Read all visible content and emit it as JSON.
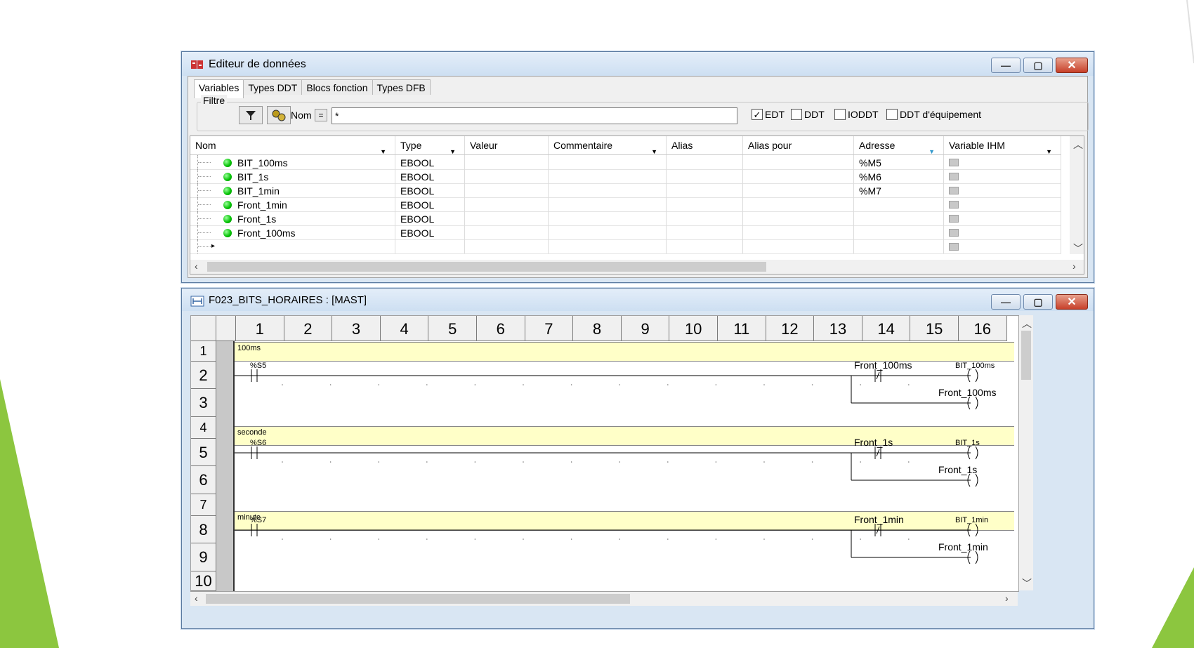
{
  "data_editor": {
    "title": "Editeur de données",
    "tabs": [
      "Variables",
      "Types DDT",
      "Blocs fonction",
      "Types DFB"
    ],
    "filter_label": "Filtre",
    "name_label": "Nom",
    "eq_label": "=",
    "name_filter_value": "*",
    "checkboxes": [
      {
        "label": "EDT",
        "checked": true
      },
      {
        "label": "DDT",
        "checked": false
      },
      {
        "label": "IODDT",
        "checked": false
      },
      {
        "label": "DDT d'équipement",
        "checked": false
      }
    ],
    "columns": [
      "Nom",
      "Type",
      "Valeur",
      "Commentaire",
      "Alias",
      "Alias pour",
      "Adresse",
      "Variable IHM"
    ],
    "rows": [
      {
        "name": "BIT_100ms",
        "type": "EBOOL",
        "address": "%M5"
      },
      {
        "name": "BIT_1s",
        "type": "EBOOL",
        "address": "%M6"
      },
      {
        "name": "BIT_1min",
        "type": "EBOOL",
        "address": "%M7"
      },
      {
        "name": "Front_1min",
        "type": "EBOOL",
        "address": ""
      },
      {
        "name": "Front_1s",
        "type": "EBOOL",
        "address": ""
      },
      {
        "name": "Front_100ms",
        "type": "EBOOL",
        "address": ""
      }
    ]
  },
  "ladder_editor": {
    "title": "F023_BITS_HORAIRES : [MAST]",
    "columns": [
      "1",
      "2",
      "3",
      "4",
      "5",
      "6",
      "7",
      "8",
      "9",
      "10",
      "11",
      "12",
      "13",
      "14",
      "15",
      "16"
    ],
    "row_numbers": [
      "1",
      "2",
      "3",
      "4",
      "5",
      "6",
      "7",
      "8",
      "9",
      "10"
    ],
    "comments": [
      "100ms",
      "seconde",
      "minute"
    ],
    "rungs": [
      {
        "contact": "%S5",
        "nc_contact": "Front_100ms",
        "coil_small": "BIT_100ms",
        "coil2": "Front_100ms"
      },
      {
        "contact": "%S6",
        "nc_contact": "Front_1s",
        "coil_small": "BIT_1s",
        "coil2": "Front_1s"
      },
      {
        "contact": "%S7",
        "nc_contact": "Front_1min",
        "coil_small": "BIT_1min",
        "coil2": "Front_1min"
      }
    ]
  },
  "colors": {
    "accent_green": "#8cc63f",
    "comment_yellow": "#ffffc8",
    "window_frame": "#d9e6f3"
  }
}
